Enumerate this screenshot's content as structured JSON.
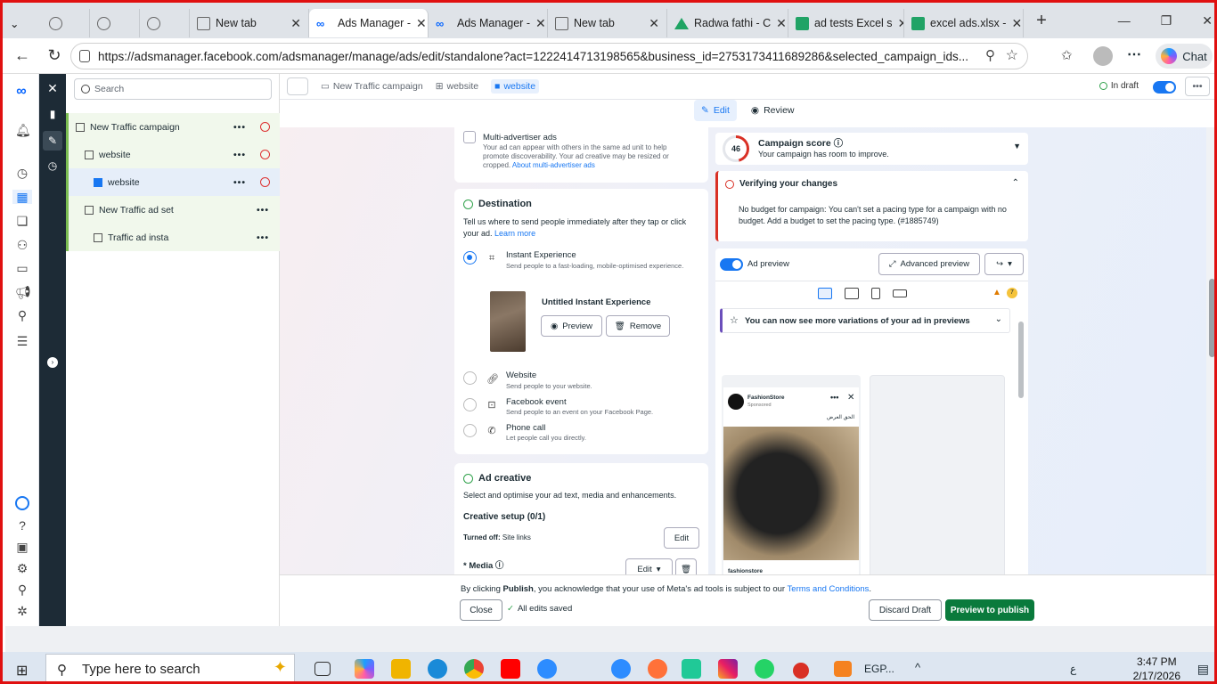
{
  "browser": {
    "tabs": [
      {
        "label": "",
        "icon": "globe-icon"
      },
      {
        "label": "",
        "icon": "globe-icon"
      },
      {
        "label": "",
        "icon": "globe-icon"
      },
      {
        "label": "New tab",
        "icon": "page-icon"
      },
      {
        "label": "Ads Manager -",
        "icon": "meta-icon",
        "active": true
      },
      {
        "label": "Ads Manager -",
        "icon": "meta-icon"
      },
      {
        "label": "New tab",
        "icon": "page-icon"
      },
      {
        "label": "Radwa fathi - C",
        "icon": "drive-icon"
      },
      {
        "label": "ad tests Excel s",
        "icon": "sheets-icon"
      },
      {
        "label": "excel ads.xlsx -",
        "icon": "sheets-icon"
      }
    ],
    "url": "https://adsmanager.facebook.com/adsmanager/manage/ads/edit/standalone?act=1222414713198565&business_id=2753173411689286&selected_campaign_ids...",
    "chat_label": "Chat"
  },
  "tree": {
    "search_placeholder": "Search",
    "rows": [
      {
        "label": "New Traffic campaign"
      },
      {
        "label": "website"
      },
      {
        "label": "website"
      },
      {
        "label": "New Traffic ad set"
      },
      {
        "label": "Traffic ad insta"
      }
    ]
  },
  "header": {
    "crumbs": [
      "New Traffic campaign",
      "website",
      "website"
    ],
    "status": "In draft",
    "edit": "Edit",
    "review": "Review"
  },
  "multi": {
    "title": "Multi-advertiser ads",
    "desc": "Your ad can appear with others in the same ad unit to help promote discoverability. Your ad creative may be resized or cropped.",
    "link": "About multi-advertiser ads"
  },
  "destination": {
    "title": "Destination",
    "desc": "Tell us where to send people immediately after they tap or click your ad.",
    "learn": "Learn more",
    "options": [
      {
        "title": "Instant Experience",
        "sub": "Send people to a fast-loading, mobile-optimised experience.",
        "selected": true
      },
      {
        "title": "Website",
        "sub": "Send people to your website.",
        "selected": false
      },
      {
        "title": "Facebook event",
        "sub": "Send people to an event on your Facebook Page.",
        "selected": false
      },
      {
        "title": "Phone call",
        "sub": "Let people call you directly.",
        "selected": false
      }
    ],
    "ie_name": "Untitled Instant Experience",
    "preview": "Preview",
    "remove": "Remove"
  },
  "creative": {
    "title": "Ad creative",
    "desc": "Select and optimise your ad text, media and enhancements.",
    "setup": "Creative setup (0/1)",
    "turned_off_label": "Turned off:",
    "turned_off_value": "Site links",
    "edit": "Edit",
    "media": "* Media"
  },
  "score": {
    "value": "46",
    "title": "Campaign score",
    "sub": "Your campaign has room to improve."
  },
  "verify": {
    "title": "Verifying your changes",
    "msg": "No budget for campaign: You can't set a pacing type for a campaign with no budget. Add a budget to set the pacing type. (#1885749)"
  },
  "preview": {
    "label": "Ad preview",
    "advanced": "Advanced preview",
    "warn_count": "7",
    "banner": "You can now see more variations of your ad in previews",
    "page_name": "FashionStore",
    "sponsored": "Sponsored",
    "caption": "الحق العرض",
    "footer": "fashionstore"
  },
  "publish": {
    "terms_pre": "By clicking ",
    "terms_bold": "Publish",
    "terms_mid": ", you acknowledge that your use of Meta's ad tools is subject to our ",
    "terms_link": "Terms and Conditions",
    "terms_end": ".",
    "close": "Close",
    "saved": "All edits saved",
    "discard": "Discard Draft",
    "publish": "Preview to publish"
  },
  "taskbar": {
    "search": "Type here to search",
    "weather": "EGP...",
    "time": "3:47 PM",
    "date": "2/17/2026",
    "lang": "ع"
  },
  "colors": {
    "accent": "#1877f2",
    "publish": "#0a7a3c",
    "error": "#d93025",
    "success": "#31a24c"
  }
}
